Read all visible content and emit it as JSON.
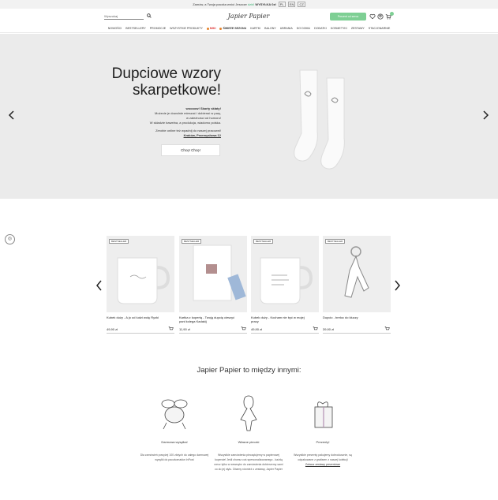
{
  "topbar": {
    "text_before": "Zamów, a Twoja paczka wróci",
    "text_mid": "Jeszcze",
    "text_highlight": "dziś!",
    "text_bold": "WYSYŁKA 0zł",
    "lang_options": [
      "PL",
      "EN",
      "CZ"
    ]
  },
  "header": {
    "search_placeholder": "Wyszukaj",
    "logo_text": "Japier Papier",
    "gift_button_label": "Prezent od serca",
    "cart_count": "0"
  },
  "nav": {
    "items": [
      "NOWOŚCI",
      "BESTSELLERY",
      "PROMOCJE",
      "WSZYSTKIE PRODUKTY",
      "MIKI",
      "ŚWIEŻE SEZONU",
      "KARTKI",
      "BALONY",
      "UBRANIA",
      "DO DOMU",
      "DODATKI",
      "KOSMETYKI",
      "ZESTAWY",
      "STACJONARNIE"
    ]
  },
  "hero": {
    "title_line1": "Dupciowe wzory",
    "title_line2": "skarpetkowe!",
    "body_bold": "woooow! Skarty skłaty!",
    "body_lines": [
      "Możecie je dowolnie mieszać i dobierać w pary,",
      "w zależności od humoru!",
      "W składzie bawełna, a produkcja, wiadomo polska."
    ],
    "invite": "Zerobie online też wpadnij do naszej pracowni!",
    "location": "Kraków, Przemysłowa 12",
    "cta": "Chcę! Chcę!"
  },
  "products": [
    {
      "badge": "BESTSELLER",
      "name": "Kubek duży - A jo od ludzi wolę Ryzki",
      "price": "49,90 zł"
    },
    {
      "badge": "BESTSELLER",
      "name": "Kartka z kopertą - Twoją dupcię cieszyć pani kolega Kadakij",
      "price": "11,90 zł"
    },
    {
      "badge": "BESTSELLER",
      "name": "Kubek duży - Kocham nie być w mojej pracy",
      "price": "49,90 zł"
    },
    {
      "badge": "BESTSELLER",
      "name": "Dupcio - breloc do kluczy",
      "price": "39,90 zł"
    }
  ],
  "features": {
    "title": "Japier Papier to między innymi:",
    "items": [
      {
        "heading": "Darmowa wysyłka!",
        "text": "Dla zamówień powyżej 100 złotych do całego darmowej wysyłki do paczkomatów InPost"
      },
      {
        "heading": "Własne pieczki",
        "text": "Wszystkie zamówienia pieczętujemy w papierowej kopercie! Jeśli chcesz coś spersonalizowanego - każdą rzecz tylko w wewnątrz do zamówienia dobierzemy sami co do jej stylu. Dbamy również o zestawy, Japier Papier",
        "link": "zestaw Japier Papier"
      },
      {
        "heading": "Prezenty!",
        "text": "Wszystkie prezenty pakujemy dobrodusznie, są odpakowane z gratisem z naszej kolekcji",
        "link": "Zobacz zestawy prezentowe"
      }
    ]
  },
  "colors": {
    "accent": "#7ecf94",
    "hero_bg": "#ebebeb",
    "card_bg": "#eeeeee"
  }
}
